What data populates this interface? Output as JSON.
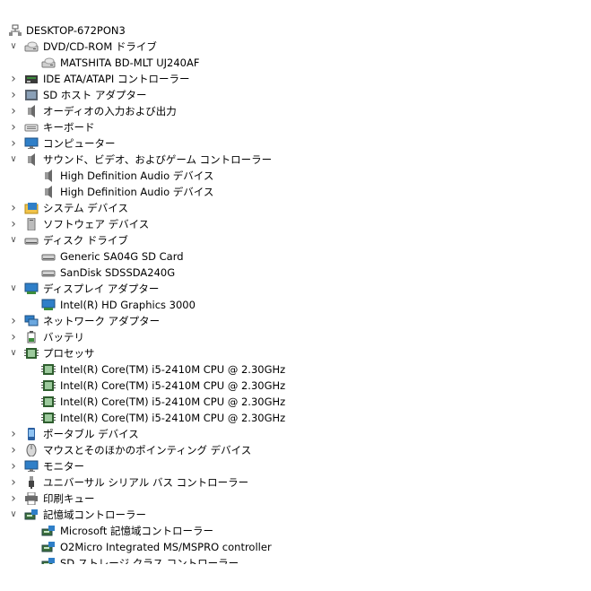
{
  "tree": {
    "root": {
      "label": "DESKTOP-672PON3",
      "icon": "computer-network-icon"
    },
    "categories": [
      {
        "label": "DVD/CD-ROM ドライブ",
        "icon": "optical-drive-icon",
        "expanded": true,
        "devices": [
          {
            "label": "MATSHITA BD-MLT UJ240AF",
            "icon": "optical-drive-icon"
          }
        ]
      },
      {
        "label": "IDE ATA/ATAPI コントローラー",
        "icon": "ide-controller-icon",
        "expanded": false,
        "devices": []
      },
      {
        "label": "SD ホスト アダプター",
        "icon": "sd-host-icon",
        "expanded": false,
        "devices": []
      },
      {
        "label": "オーディオの入力および出力",
        "icon": "speaker-icon",
        "expanded": false,
        "devices": []
      },
      {
        "label": "キーボード",
        "icon": "keyboard-icon",
        "expanded": false,
        "devices": []
      },
      {
        "label": "コンピューター",
        "icon": "monitor-icon",
        "expanded": false,
        "devices": []
      },
      {
        "label": "サウンド、ビデオ、およびゲーム コントローラー",
        "icon": "speaker-icon",
        "expanded": true,
        "devices": [
          {
            "label": "High Definition Audio デバイス",
            "icon": "speaker-icon"
          },
          {
            "label": "High Definition Audio デバイス",
            "icon": "speaker-icon"
          }
        ]
      },
      {
        "label": "システム デバイス",
        "icon": "system-folder-icon",
        "expanded": false,
        "devices": []
      },
      {
        "label": "ソフトウェア デバイス",
        "icon": "software-device-icon",
        "expanded": false,
        "devices": []
      },
      {
        "label": "ディスク ドライブ",
        "icon": "disk-drive-icon",
        "expanded": true,
        "devices": [
          {
            "label": "Generic SA04G SD Card",
            "icon": "disk-drive-icon"
          },
          {
            "label": "SanDisk SDSSDA240G",
            "icon": "disk-drive-icon"
          }
        ]
      },
      {
        "label": "ディスプレイ アダプター",
        "icon": "display-adapter-icon",
        "expanded": true,
        "devices": [
          {
            "label": "Intel(R) HD Graphics 3000",
            "icon": "display-adapter-icon"
          }
        ]
      },
      {
        "label": "ネットワーク アダプター",
        "icon": "network-adapter-icon",
        "expanded": false,
        "devices": []
      },
      {
        "label": "バッテリ",
        "icon": "battery-icon",
        "expanded": false,
        "devices": []
      },
      {
        "label": "プロセッサ",
        "icon": "processor-icon",
        "expanded": true,
        "devices": [
          {
            "label": "Intel(R) Core(TM) i5-2410M CPU @ 2.30GHz",
            "icon": "processor-icon"
          },
          {
            "label": "Intel(R) Core(TM) i5-2410M CPU @ 2.30GHz",
            "icon": "processor-icon"
          },
          {
            "label": "Intel(R) Core(TM) i5-2410M CPU @ 2.30GHz",
            "icon": "processor-icon"
          },
          {
            "label": "Intel(R) Core(TM) i5-2410M CPU @ 2.30GHz",
            "icon": "processor-icon"
          }
        ]
      },
      {
        "label": "ポータブル デバイス",
        "icon": "portable-device-icon",
        "expanded": false,
        "devices": []
      },
      {
        "label": "マウスとそのほかのポインティング デバイス",
        "icon": "mouse-icon",
        "expanded": false,
        "devices": []
      },
      {
        "label": "モニター",
        "icon": "monitor-icon",
        "expanded": false,
        "devices": []
      },
      {
        "label": "ユニバーサル シリアル バス コントローラー",
        "icon": "usb-icon",
        "expanded": false,
        "devices": []
      },
      {
        "label": "印刷キュー",
        "icon": "printer-icon",
        "expanded": false,
        "devices": []
      },
      {
        "label": "記憶域コントローラー",
        "icon": "storage-controller-icon",
        "expanded": true,
        "devices": [
          {
            "label": "Microsoft 記憶域コントローラー",
            "icon": "storage-controller-icon"
          },
          {
            "label": "O2Micro Integrated MS/MSPRO controller",
            "icon": "storage-controller-icon"
          },
          {
            "label": "SD ストレージ クラス コントローラー",
            "icon": "storage-controller-icon"
          }
        ]
      }
    ]
  },
  "colors": {
    "chevron": "#555555",
    "icon_blue": "#2f7fc8",
    "icon_green": "#3c8c3c",
    "icon_gray": "#8a8a8a"
  }
}
